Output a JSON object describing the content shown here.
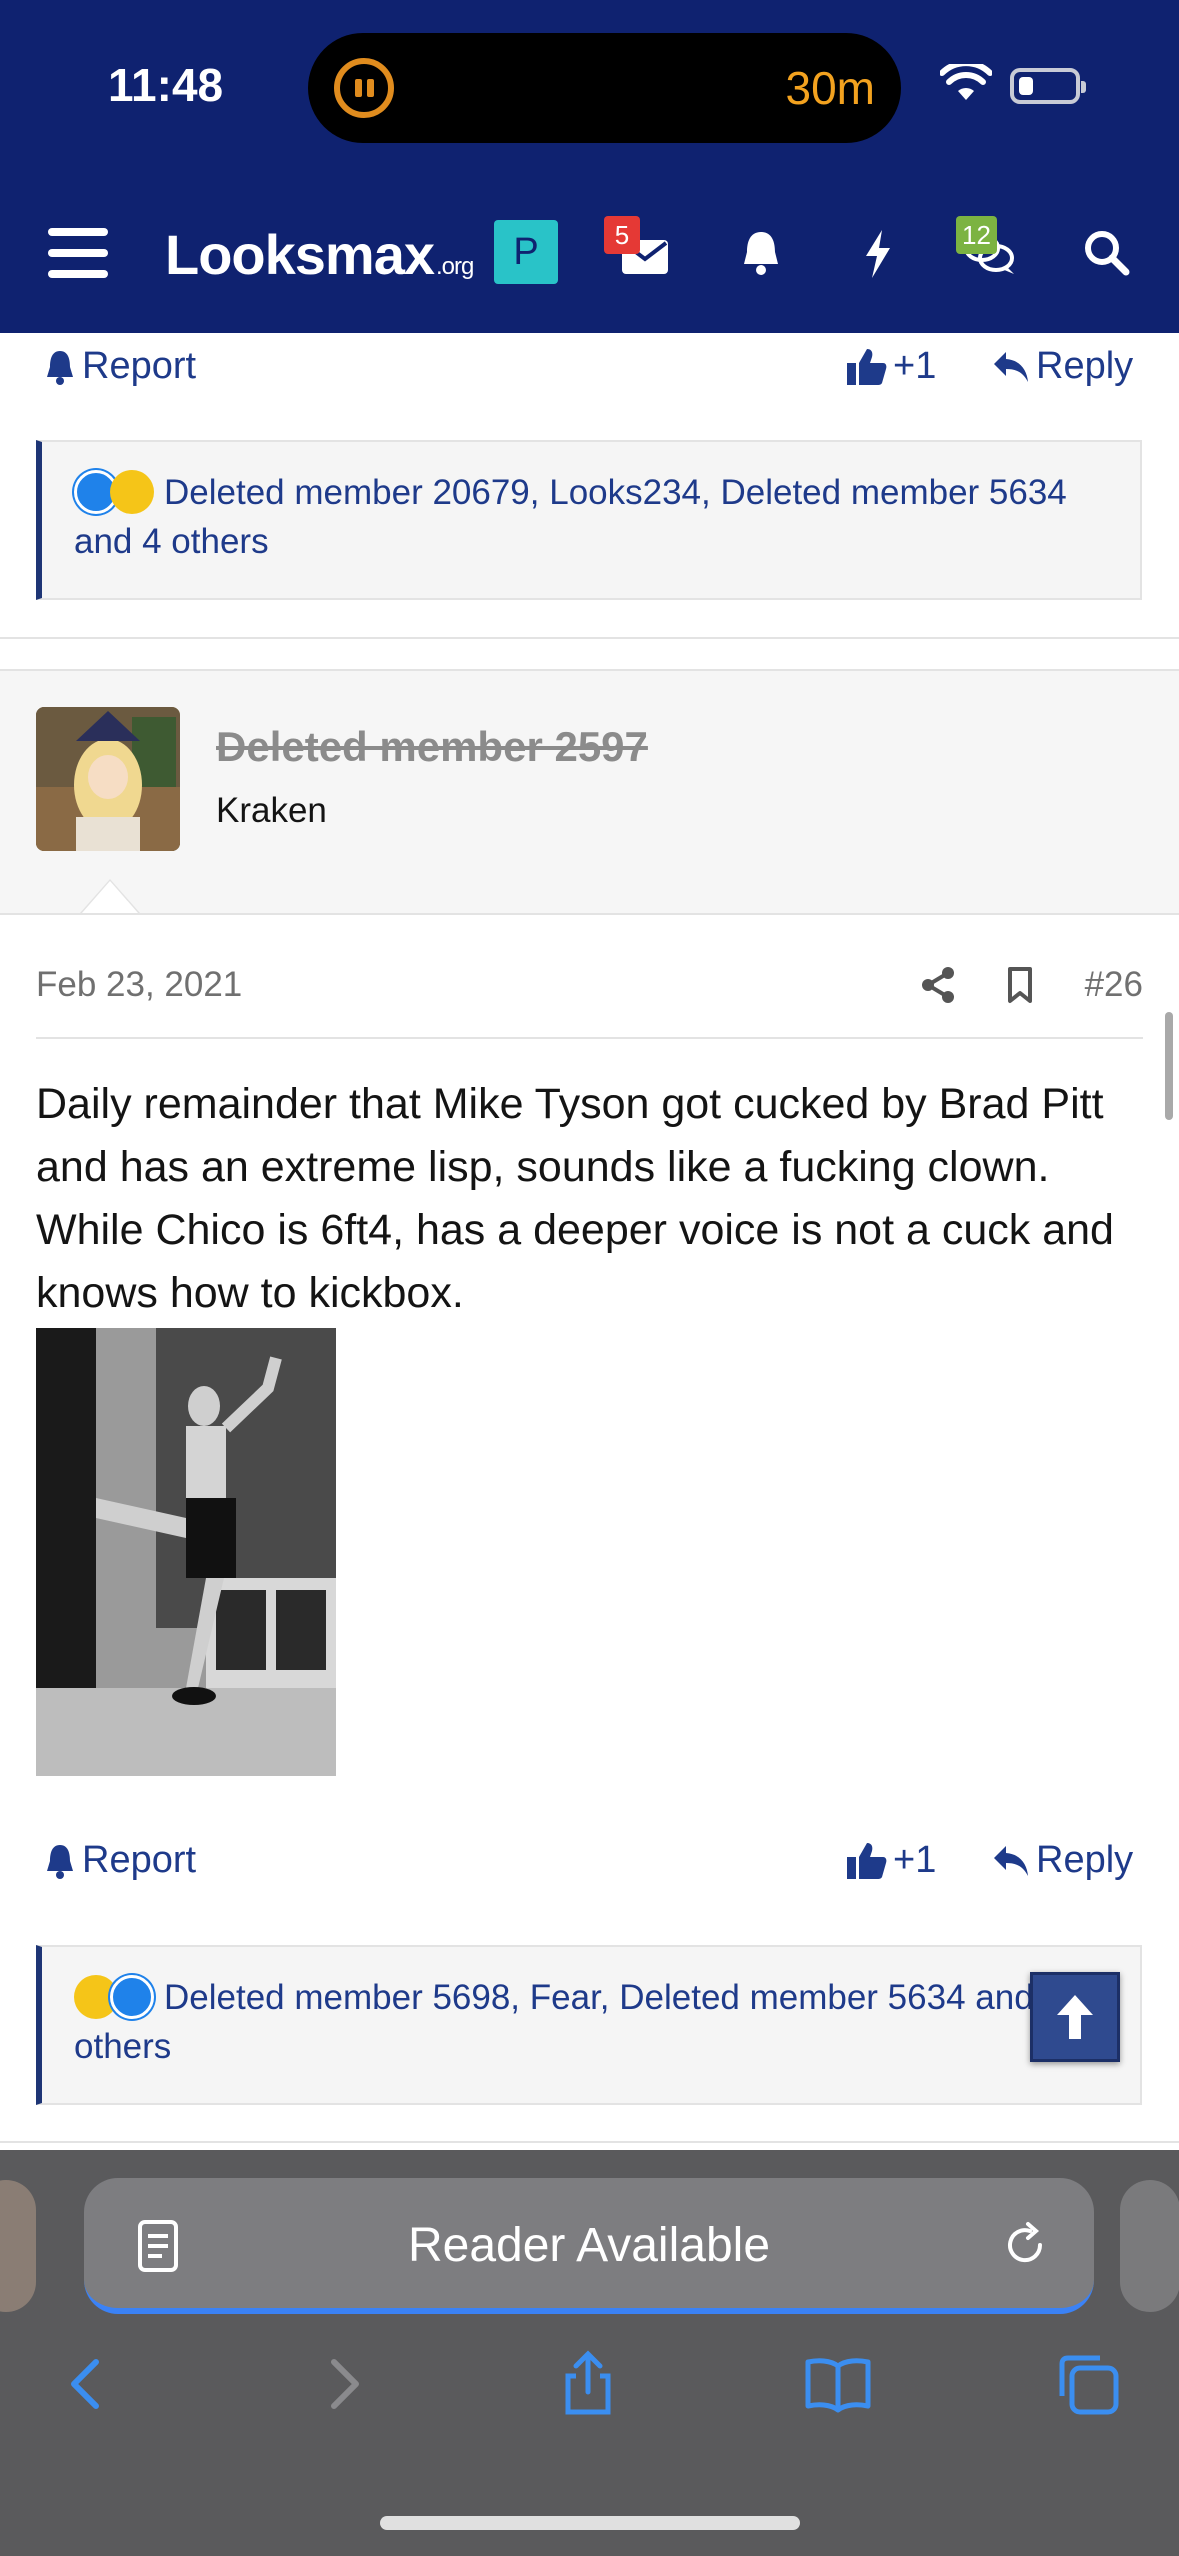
{
  "status_bar": {
    "time": "11:48",
    "timer": "30m"
  },
  "header": {
    "logo_main": "Looksmax",
    "logo_suffix": ".org",
    "p_badge": "P",
    "inbox_badge": "5",
    "chat_badge": "12",
    "colors": {
      "bar": "#0f2270",
      "badge_red": "#e53935",
      "badge_green": "#7cb342",
      "p_badge": "#29c3c8"
    }
  },
  "previous_post": {
    "report_label": "Report",
    "like_label": "+1",
    "reply_label": "Reply",
    "reactions_text": "Deleted member 20679, Looks234, Deleted member 5634 and 4 others"
  },
  "post": {
    "username": "Deleted member 2597",
    "user_title": "Kraken",
    "date": "Feb 23, 2021",
    "number": "#26",
    "body": "Daily remainder that Mike Tyson got cucked by Brad Pitt and has an extreme lisp, sounds like a fucking clown. While Chico is 6ft4, has a deeper voice is not a cuck and knows how to kickbox.",
    "report_label": "Report",
    "like_label": "+1",
    "reply_label": "Reply",
    "reactions_text": "Deleted member 5698, Fear, Deleted member 5634 and 3 others"
  },
  "safari": {
    "address_label": "Reader Available"
  },
  "icons": [
    "menu-icon",
    "inbox-icon",
    "bell-icon",
    "bolt-icon",
    "chat-icon",
    "search-icon",
    "share-icon",
    "bookmark-icon",
    "thumbs-up-icon",
    "reply-icon",
    "reader-icon",
    "reload-icon",
    "back-icon",
    "forward-icon",
    "share-sheet-icon",
    "bookmarks-book-icon",
    "tabs-icon",
    "arrow-up-icon"
  ]
}
